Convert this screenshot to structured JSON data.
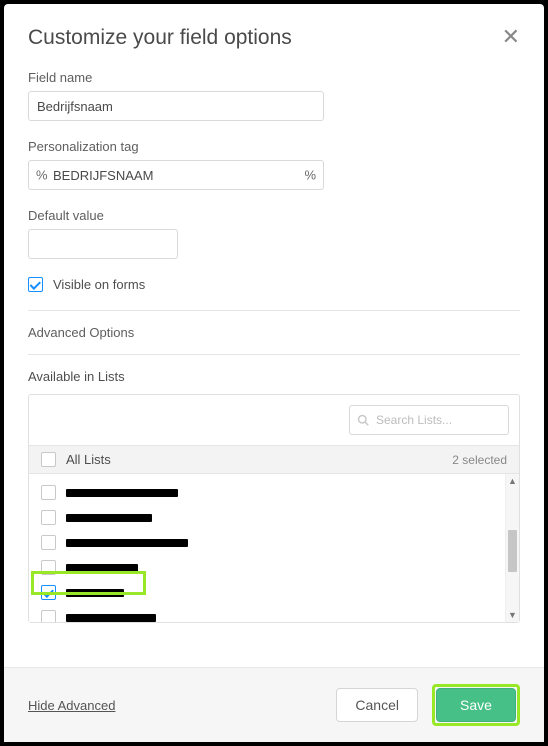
{
  "title": "Customize your field options",
  "field_name": {
    "label": "Field name",
    "value": "Bedrijfsnaam"
  },
  "personalization_tag": {
    "label": "Personalization tag",
    "value": "BEDRIJFSNAAM",
    "prefix": "%",
    "suffix": "%"
  },
  "default_value": {
    "label": "Default value",
    "value": ""
  },
  "visible_on_forms": {
    "label": "Visible on forms",
    "checked": true
  },
  "advanced_options": {
    "label": "Advanced Options"
  },
  "available": {
    "label": "Available in Lists",
    "all_label": "All Lists",
    "selected_text": "2 selected",
    "search_placeholder": "Search Lists...",
    "items": [
      {
        "checked": false,
        "width": 112
      },
      {
        "checked": false,
        "width": 86
      },
      {
        "checked": false,
        "width": 122
      },
      {
        "checked": false,
        "width": 72
      },
      {
        "checked": true,
        "width": 58
      },
      {
        "checked": false,
        "width": 90
      }
    ]
  },
  "footer": {
    "hide_advanced": "Hide Advanced",
    "cancel": "Cancel",
    "save": "Save"
  }
}
